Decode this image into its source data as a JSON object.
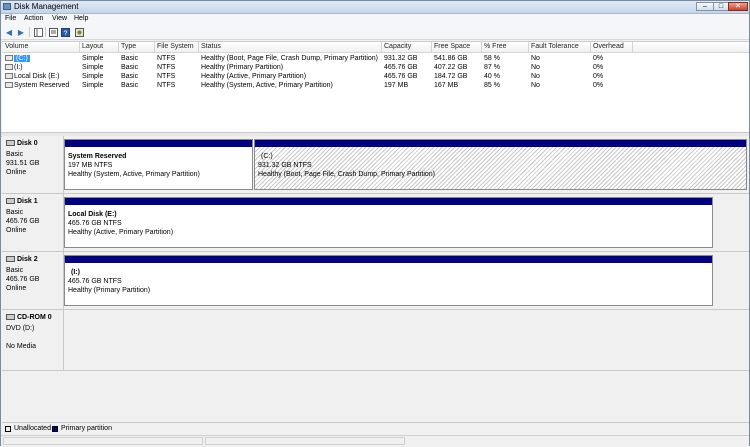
{
  "window": {
    "title": "Disk Management"
  },
  "menu": [
    "File",
    "Action",
    "View",
    "Help"
  ],
  "toolbar": {
    "icons": [
      "back-icon",
      "forward-icon",
      "console-tree-icon",
      "properties-icon",
      "help-icon",
      "refresh-icon"
    ]
  },
  "volume_list": {
    "columns": [
      "Volume",
      "Layout",
      "Type",
      "File System",
      "Status",
      "Capacity",
      "Free Space",
      "% Free",
      "Fault Tolerance",
      "Overhead"
    ],
    "rows": [
      {
        "volume": "(C:)",
        "layout": "Simple",
        "type": "Basic",
        "fs": "NTFS",
        "status": "Healthy (Boot, Page File, Crash Dump, Primary Partition)",
        "capacity": "931.32 GB",
        "free": "541.86 GB",
        "pct": "58 %",
        "fault": "No",
        "overhead": "0%"
      },
      {
        "volume": "(I:)",
        "layout": "Simple",
        "type": "Basic",
        "fs": "NTFS",
        "status": "Healthy (Primary Partition)",
        "capacity": "465.76 GB",
        "free": "407.22 GB",
        "pct": "87 %",
        "fault": "No",
        "overhead": "0%"
      },
      {
        "volume": "Local Disk (E:)",
        "layout": "Simple",
        "type": "Basic",
        "fs": "NTFS",
        "status": "Healthy (Active, Primary Partition)",
        "capacity": "465.76 GB",
        "free": "184.72 GB",
        "pct": "40 %",
        "fault": "No",
        "overhead": "0%"
      },
      {
        "volume": "System Reserved",
        "layout": "Simple",
        "type": "Basic",
        "fs": "NTFS",
        "status": "Healthy (System, Active, Primary Partition)",
        "capacity": "197 MB",
        "free": "167 MB",
        "pct": "85 %",
        "fault": "No",
        "overhead": "0%"
      }
    ]
  },
  "disks": [
    {
      "name": "Disk 0",
      "kind": "Basic",
      "size": "931.51 GB",
      "state": "Online",
      "partitions": [
        {
          "title": "System Reserved",
          "size": "197 MB NTFS",
          "status": "Healthy (System, Active, Primary Partition)"
        },
        {
          "title": "(C:)",
          "size": "931.32 GB NTFS",
          "status": "Healthy (Boot, Page File, Crash Dump, Primary Partition)"
        }
      ]
    },
    {
      "name": "Disk 1",
      "kind": "Basic",
      "size": "465.76 GB",
      "state": "Online",
      "partitions": [
        {
          "title": "Local Disk  (E:)",
          "size": "465.76 GB NTFS",
          "status": "Healthy (Active, Primary Partition)"
        }
      ]
    },
    {
      "name": "Disk 2",
      "kind": "Basic",
      "size": "465.76 GB",
      "state": "Online",
      "partitions": [
        {
          "title": "(I:)",
          "size": "465.76 GB NTFS",
          "status": "Healthy (Primary Partition)"
        }
      ]
    },
    {
      "name": "CD-ROM 0",
      "kind": "DVD (D:)",
      "size": "",
      "state": "No Media",
      "partitions": []
    }
  ],
  "legend": [
    {
      "label": "Unallocated",
      "color": "#000000"
    },
    {
      "label": "Primary partition",
      "color": "#000080"
    }
  ],
  "colors": {
    "partition_bar": "#000080",
    "selection": "#3399ff"
  }
}
